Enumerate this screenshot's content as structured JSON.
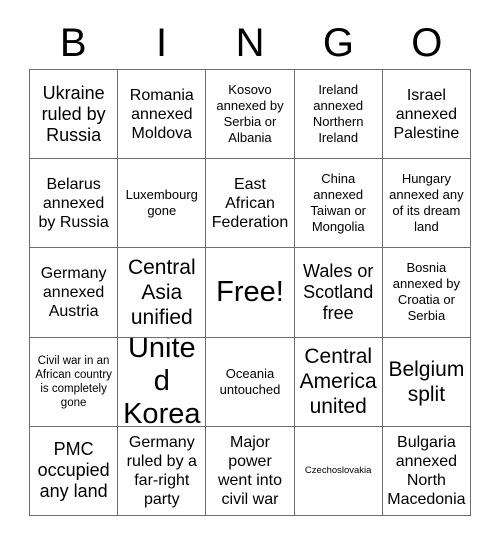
{
  "card": {
    "title": "BINGO",
    "header_letters": [
      "B",
      "I",
      "N",
      "G",
      "O"
    ],
    "grid_size": "5x5",
    "free_space_text": "Free!",
    "colors": {
      "text": "#000000",
      "background": "#ffffff",
      "grid_line": "#6d6d6d"
    },
    "rows": [
      {
        "cells": [
          {
            "text": "Ukraine ruled by Russia",
            "size": "lg"
          },
          {
            "text": "Romania annexed Moldova",
            "size": "md"
          },
          {
            "text": "Kosovo annexed by Serbia or Albania",
            "size": "sm"
          },
          {
            "text": "Ireland annexed Northern Ireland",
            "size": "sm"
          },
          {
            "text": "Israel annexed Palestine",
            "size": "md"
          }
        ]
      },
      {
        "cells": [
          {
            "text": "Belarus annexed by Russia",
            "size": "md"
          },
          {
            "text": "Luxembourg gone",
            "size": "sm"
          },
          {
            "text": "East African Federation",
            "size": "md"
          },
          {
            "text": "China annexed Taiwan or Mongolia",
            "size": "sm"
          },
          {
            "text": "Hungary annexed any of its dream land",
            "size": "sm"
          }
        ]
      },
      {
        "cells": [
          {
            "text": "Germany annexed Austria",
            "size": "md"
          },
          {
            "text": "Central Asia unified",
            "size": "xl"
          },
          {
            "text": "Free!",
            "size": "xxl"
          },
          {
            "text": "Wales or Scotland free",
            "size": "lg"
          },
          {
            "text": "Bosnia annexed by Croatia or Serbia",
            "size": "sm"
          }
        ]
      },
      {
        "cells": [
          {
            "text": "Civil war in an African country is completely gone",
            "size": "xs"
          },
          {
            "text": "United Korea",
            "size": "xxl"
          },
          {
            "text": "Oceania untouched",
            "size": "sm"
          },
          {
            "text": "Central America united",
            "size": "xl"
          },
          {
            "text": "Belgium split",
            "size": "xl"
          }
        ]
      },
      {
        "cells": [
          {
            "text": "PMC occupied any land",
            "size": "lg"
          },
          {
            "text": "Germany ruled by a far-right party",
            "size": "md"
          },
          {
            "text": "Major power went into civil war",
            "size": "md"
          },
          {
            "text": "Czechoslovakia",
            "size": "xxs"
          },
          {
            "text": "Bulgaria annexed North Macedonia",
            "size": "md"
          }
        ]
      }
    ]
  }
}
